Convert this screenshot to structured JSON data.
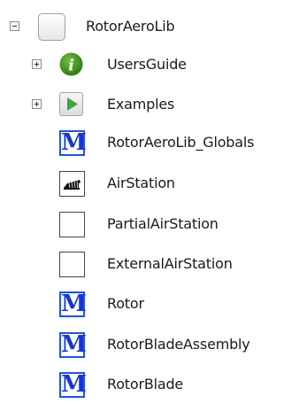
{
  "tree": {
    "root": {
      "label": "RotorAeroLib",
      "icon": "package-icon",
      "expanded": true
    },
    "items": [
      {
        "label": "UsersGuide",
        "icon": "info-icon",
        "expandable": true,
        "expanded": false
      },
      {
        "label": "Examples",
        "icon": "play-icon",
        "expandable": true,
        "expanded": false
      },
      {
        "label": "RotorAeroLib_Globals",
        "icon": "model-m-icon"
      },
      {
        "label": "AirStation",
        "icon": "airstation-icon"
      },
      {
        "label": "PartialAirStation",
        "icon": "blank-class-icon"
      },
      {
        "label": "ExternalAirStation",
        "icon": "blank-class-icon"
      },
      {
        "label": "Rotor",
        "icon": "model-m-icon"
      },
      {
        "label": "RotorBladeAssembly",
        "icon": "model-m-icon"
      },
      {
        "label": "RotorBlade",
        "icon": "model-m-icon"
      }
    ]
  },
  "icons": {
    "model_letter": "M"
  },
  "colors": {
    "model_blue": "#1f4fff",
    "info_green": "#3f8a1f",
    "play_green": "#3ca83c",
    "text": "#1a1a1a"
  }
}
